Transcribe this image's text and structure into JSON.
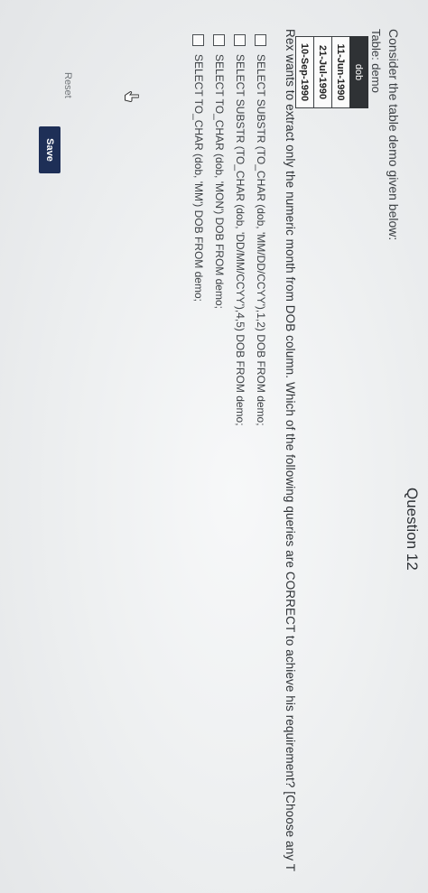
{
  "question": {
    "title": "Question 12",
    "intro": "Consider the table demo given below:",
    "table_label": "Table: demo",
    "table": {
      "header": "dob",
      "rows": [
        "11-Jun-1990",
        "21-Jul-1990",
        "10-Sep-1990"
      ]
    },
    "prompt": "Rex wants to extract only the numeric month from DOB column. Which of the following queries are CORRECT to achieve his requirement? [Choose any T"
  },
  "options": [
    "SELECT SUBSTR (TO_CHAR (dob, 'MM/DD/CCYY'),1,2) DOB FROM demo;",
    "SELECT SUBSTR (TO_CHAR (dob, 'DD/MM/CCYY'),4,5) DOB FROM demo;",
    "SELECT TO_CHAR (dob, 'MON') DOB FROM demo;",
    "SELECT TO_CHAR (dob, 'MM') DOB FROM demo;"
  ],
  "actions": {
    "reset": "Reset",
    "save": "Save"
  }
}
